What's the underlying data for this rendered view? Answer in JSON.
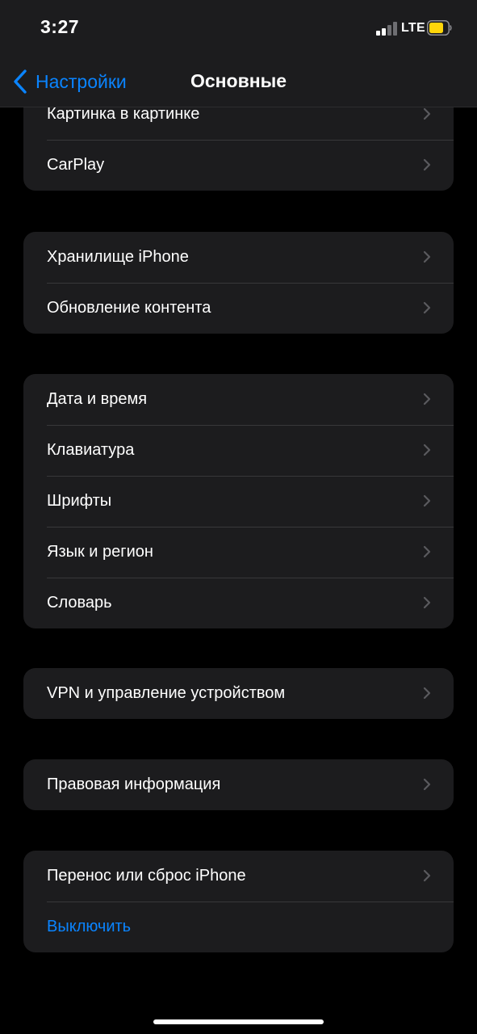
{
  "status_bar": {
    "time": "3:27",
    "network": "LTE",
    "signal_bars_active": 2,
    "signal_bars_total": 4,
    "battery_color": "#ffd60a"
  },
  "nav": {
    "back_label": "Настройки",
    "title": "Основные"
  },
  "colors": {
    "accent": "#0a84ff",
    "background": "#000000",
    "cell_background": "#1c1c1e",
    "separator": "#38383a",
    "chevron": "#5a5a5e"
  },
  "groups": [
    {
      "rows": [
        {
          "label": "Картинка в картинке"
        },
        {
          "label": "CarPlay"
        }
      ]
    },
    {
      "rows": [
        {
          "label": "Хранилище iPhone"
        },
        {
          "label": "Обновление контента"
        }
      ]
    },
    {
      "rows": [
        {
          "label": "Дата и время"
        },
        {
          "label": "Клавиатура"
        },
        {
          "label": "Шрифты"
        },
        {
          "label": "Язык и регион"
        },
        {
          "label": "Словарь"
        }
      ]
    },
    {
      "rows": [
        {
          "label": "VPN и управление устройством"
        }
      ]
    },
    {
      "rows": [
        {
          "label": "Правовая информация"
        }
      ]
    },
    {
      "rows": [
        {
          "label": "Перенос или сброс iPhone"
        }
      ]
    }
  ],
  "shutdown_label": "Выключить",
  "icons": {
    "back": "chevron-left-icon",
    "row_disclosure": "chevron-right-icon",
    "signal": "cellular-signal-icon",
    "battery": "battery-icon"
  }
}
